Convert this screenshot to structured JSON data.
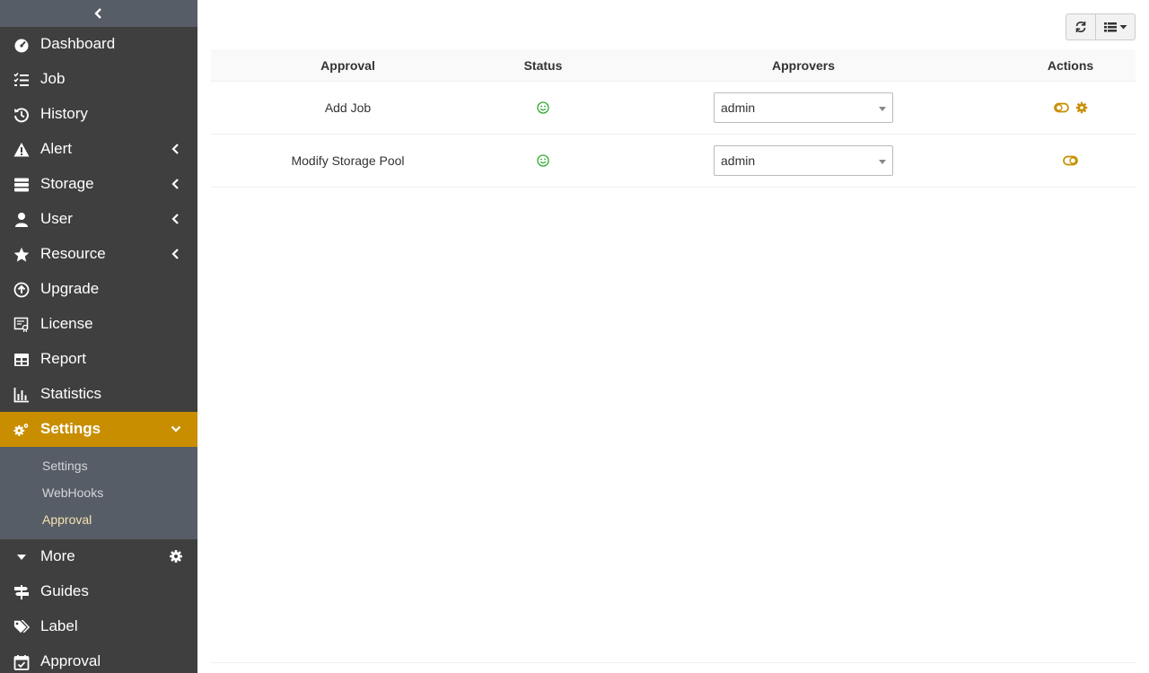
{
  "sidebar": {
    "items": [
      {
        "label": "Dashboard"
      },
      {
        "label": "Job"
      },
      {
        "label": "History"
      },
      {
        "label": "Alert"
      },
      {
        "label": "Storage"
      },
      {
        "label": "User"
      },
      {
        "label": "Resource"
      },
      {
        "label": "Upgrade"
      },
      {
        "label": "License"
      },
      {
        "label": "Report"
      },
      {
        "label": "Statistics"
      },
      {
        "label": "Settings"
      }
    ],
    "submenu": [
      {
        "label": "Settings"
      },
      {
        "label": "WebHooks"
      },
      {
        "label": "Approval"
      }
    ],
    "more_label": "More",
    "bottom_items": [
      {
        "label": "Guides"
      },
      {
        "label": "Label"
      },
      {
        "label": "Approval"
      }
    ]
  },
  "table": {
    "headers": [
      "Approval",
      "Status",
      "Approvers",
      "Actions"
    ],
    "rows": [
      {
        "approval": "Add Job",
        "approver": "admin",
        "status_icon": "smile-icon"
      },
      {
        "approval": "Modify Storage Pool",
        "approver": "admin",
        "status_icon": "smile-icon"
      }
    ]
  },
  "colors": {
    "accent": "#c88e00",
    "sidebar_bg": "#3f3f3f",
    "submenu_bg": "#575d66",
    "status_ok": "#2eaa2e"
  }
}
